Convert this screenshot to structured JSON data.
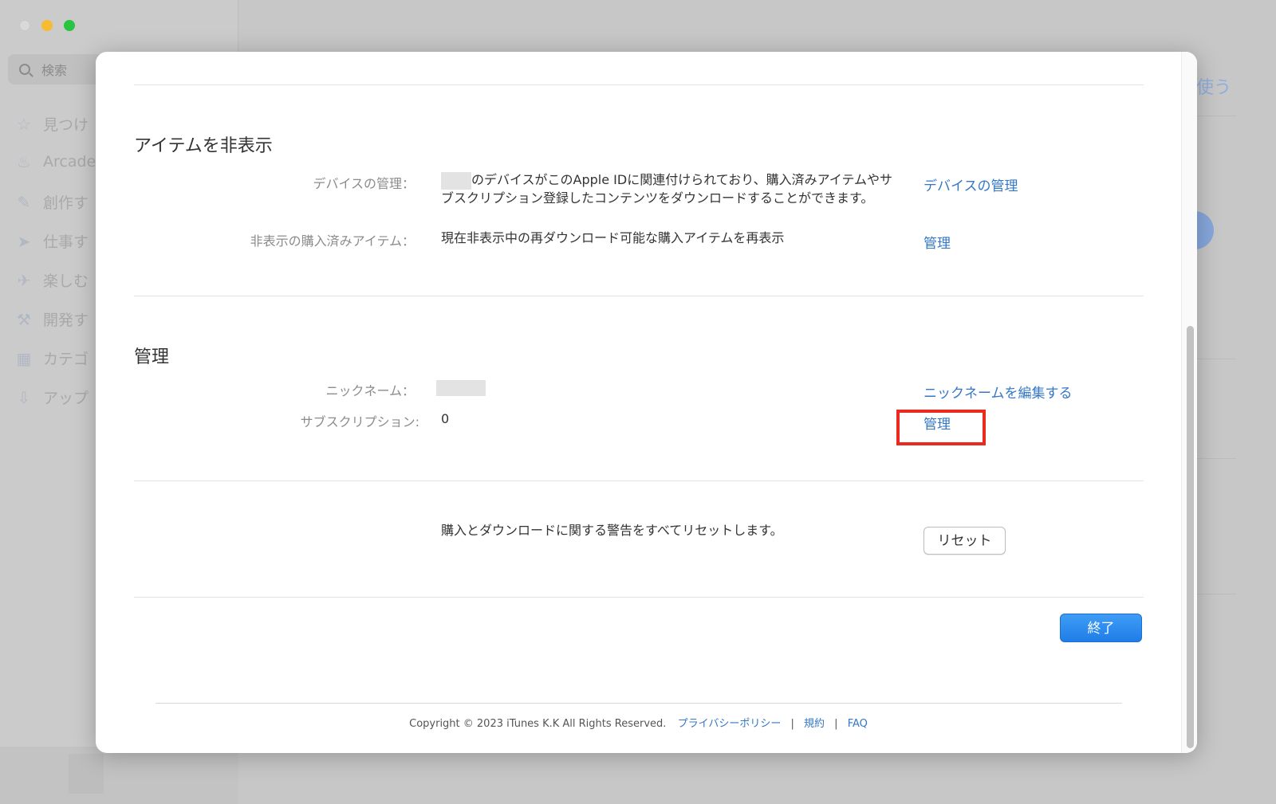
{
  "background": {
    "search_placeholder": "検索",
    "nav_items": [
      "見つけ",
      "Arcade",
      "創作す",
      "仕事す",
      "楽しむ",
      "開発す",
      "カテゴ",
      "アップ"
    ],
    "main_partial_text": "使う"
  },
  "sections": {
    "hidden_items": {
      "title": "アイテムを非表示",
      "rows": [
        {
          "label": "デバイスの管理：",
          "value_suffix": "のデバイスがこのApple IDに関連付けられており、購入済みアイテムやサブスクリプション登録したコンテンツをダウンロードすることができます。",
          "link": "デバイスの管理"
        },
        {
          "label": "非表示の購入済みアイテム：",
          "value": "現在非表示中の再ダウンロード可能な購入アイテムを再表示",
          "link": "管理"
        }
      ]
    },
    "management": {
      "title": "管理",
      "rows": [
        {
          "label": "ニックネーム：",
          "link": "ニックネームを編集する"
        },
        {
          "label": "サブスクリプション:",
          "value": "0",
          "link": "管理"
        }
      ]
    },
    "reset": {
      "text": "購入とダウンロードに関する警告をすべてリセットします。",
      "button": "リセット"
    }
  },
  "done_button": "終了",
  "footer": {
    "copyright": "Copyright © 2023 iTunes K.K All Rights Reserved.",
    "privacy": "プライバシーポリシー",
    "terms": "規約",
    "faq": "FAQ",
    "separator": "|"
  },
  "colors": {
    "link": "#3477c6",
    "highlight": "#ea2a1f",
    "primary_button": "#2a8cf0"
  }
}
